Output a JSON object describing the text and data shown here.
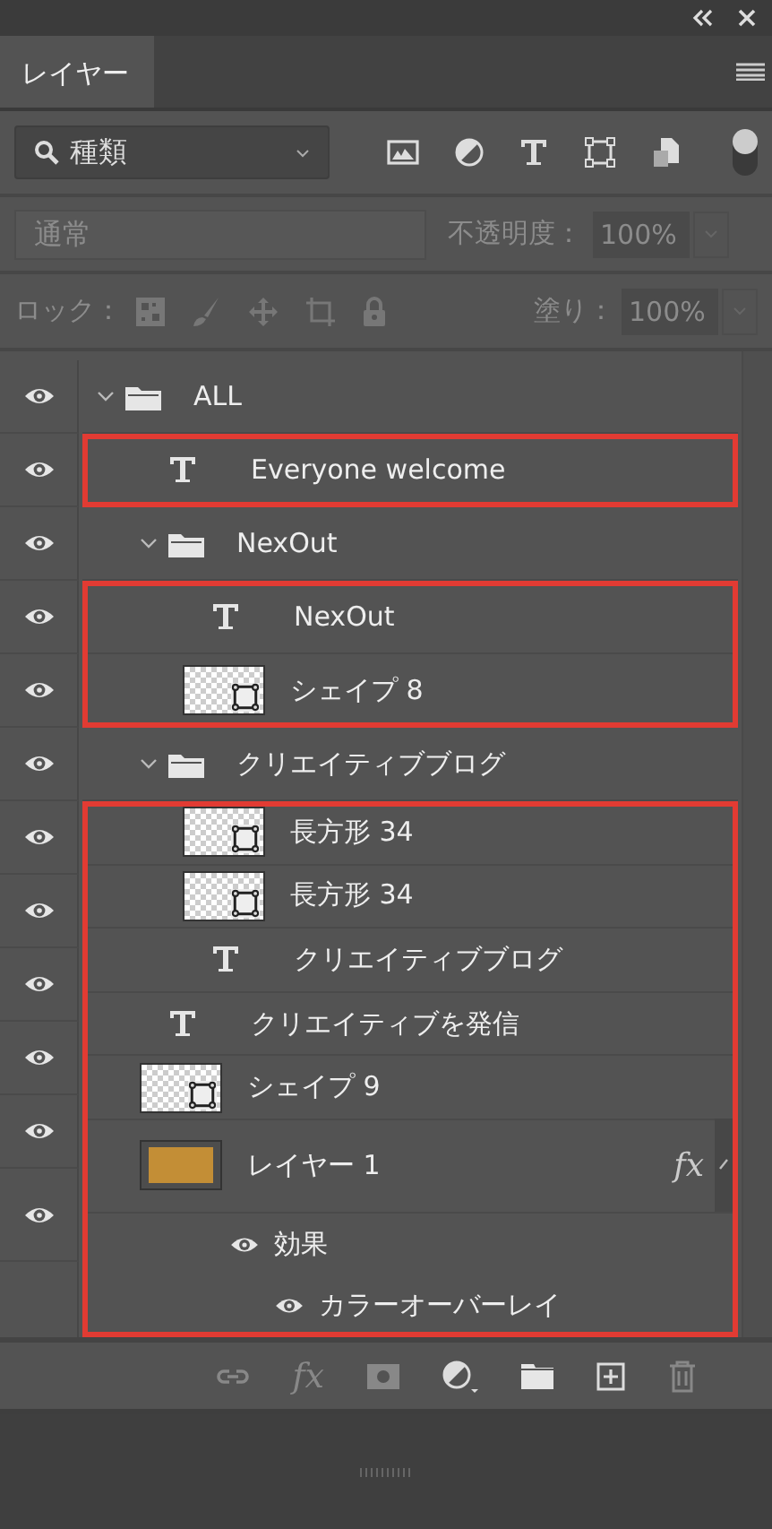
{
  "panel": {
    "tabs": [
      {
        "label": "レイヤー",
        "selected": true
      }
    ]
  },
  "filter": {
    "value": "種類",
    "toggle_on": true
  },
  "blend": {
    "mode": "通常",
    "opacity_label": "不透明度：",
    "opacity": "100%",
    "disabled": true
  },
  "lock": {
    "label": "ロック：",
    "fill_label": "塗り：",
    "fill": "100%",
    "disabled": true
  },
  "layers": [
    {
      "kind": "group",
      "name": "ALL",
      "visible": true,
      "expanded": true,
      "marked": false,
      "children": [
        {
          "kind": "text",
          "name": "Everyone welcome",
          "visible": true,
          "marked": true
        },
        {
          "kind": "group",
          "name": "NexOut",
          "visible": true,
          "expanded": true,
          "marked": false,
          "children": [
            {
              "kind": "text",
              "name": "NexOut",
              "visible": true,
              "marked": true
            },
            {
              "kind": "shape",
              "name": "シェイプ 8",
              "visible": true,
              "marked": true
            }
          ]
        },
        {
          "kind": "group",
          "name": "クリエイティブブログ",
          "visible": true,
          "expanded": true,
          "marked": false,
          "children": [
            {
              "kind": "shape",
              "name": "長方形 34",
              "visible": true,
              "marked": true
            },
            {
              "kind": "shape",
              "name": "長方形 34",
              "visible": true,
              "marked": true
            },
            {
              "kind": "text",
              "name": "クリエイティブブログ",
              "visible": true,
              "marked": true
            }
          ]
        },
        {
          "kind": "text",
          "name": "クリエイティブを発信",
          "visible": true,
          "marked": true
        },
        {
          "kind": "shape",
          "name": "シェイプ 9",
          "visible": true,
          "marked": true
        },
        {
          "kind": "pixel",
          "name": "レイヤー 1",
          "visible": true,
          "marked": true,
          "fx": "fx",
          "children": [
            {
              "kind": "effects",
              "name": "効果",
              "visible": true,
              "marked": true,
              "children": [
                {
                  "kind": "effect",
                  "name": "カラーオーバーレイ",
                  "visible": true,
                  "marked": true
                }
              ]
            }
          ]
        }
      ]
    }
  ],
  "footer": {
    "fx": "fx"
  }
}
